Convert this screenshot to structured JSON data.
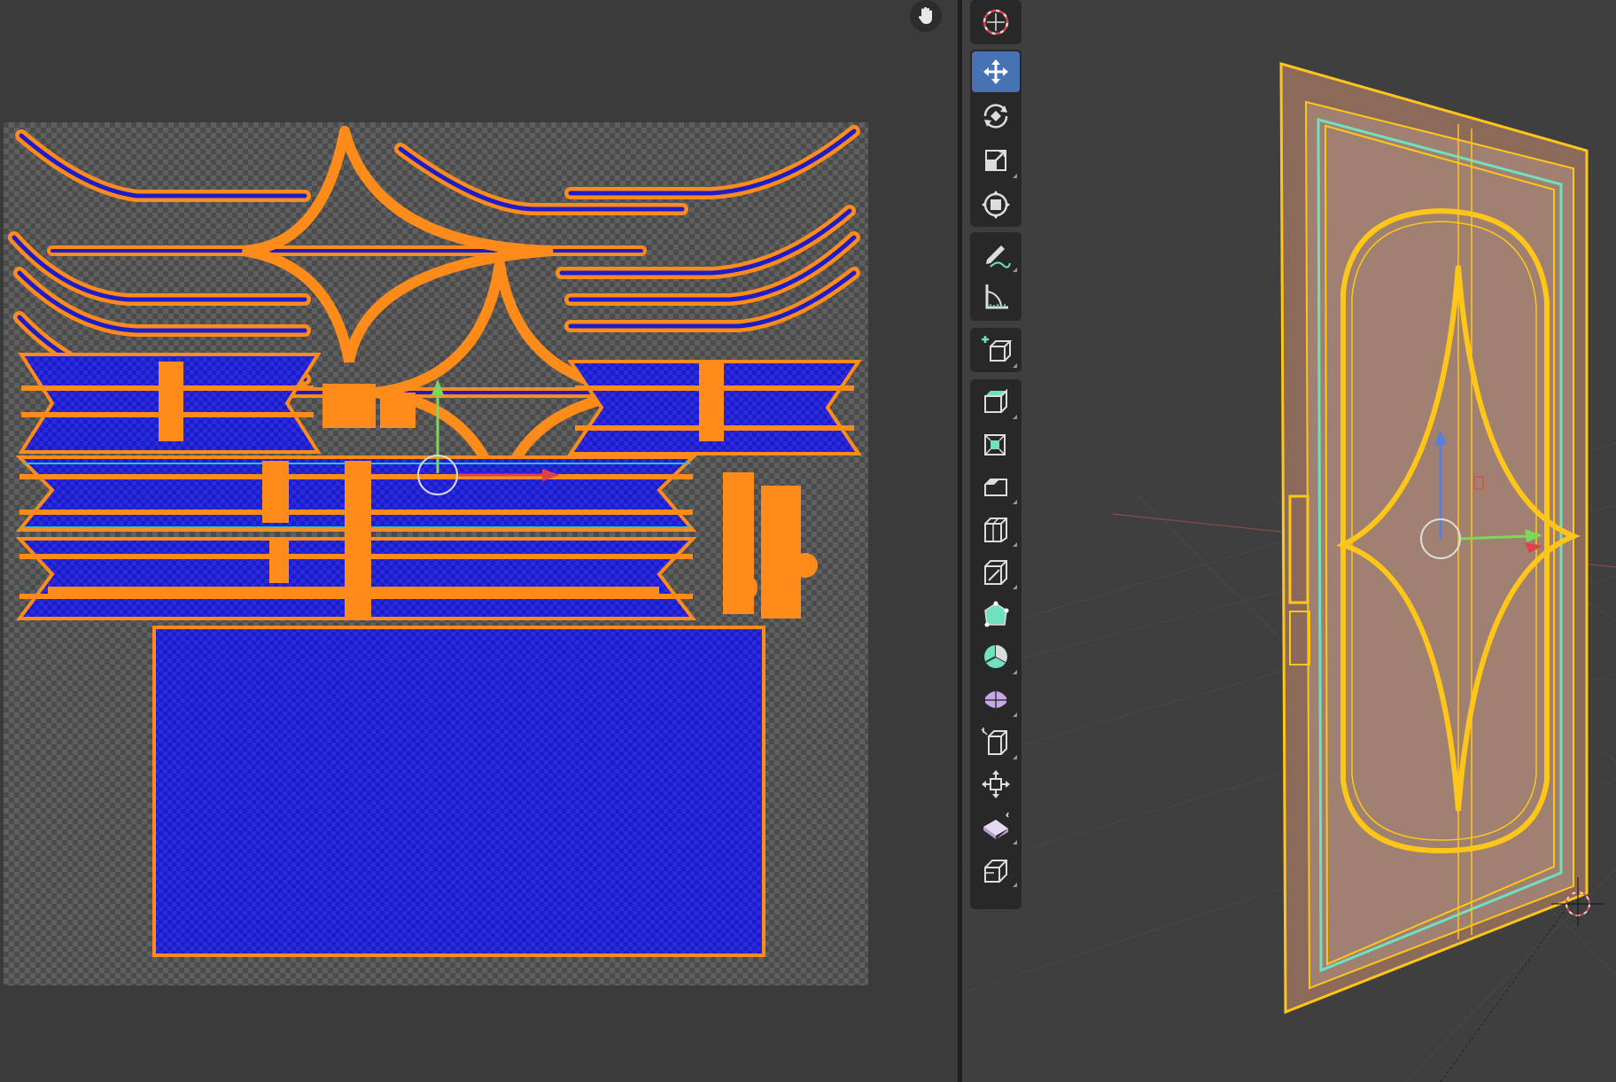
{
  "uv_editor": {
    "background": "#3b3b3b",
    "hand_icon": "hand-pan-icon",
    "selection_color": "#ff8c1a",
    "face_color": "#1f1fd6"
  },
  "viewport": {
    "background": "#3f3f3f",
    "object": "door-mesh",
    "object_color": "#ffc61a",
    "panel_fill": "#a08070"
  },
  "toolbar": {
    "tools": [
      {
        "id": "cursor",
        "icon": "cursor-icon",
        "active": false
      },
      {
        "id": "move",
        "icon": "move-icon",
        "active": true
      },
      {
        "id": "rotate",
        "icon": "rotate-icon",
        "active": false
      },
      {
        "id": "scale",
        "icon": "scale-icon",
        "active": false
      },
      {
        "id": "transform",
        "icon": "transform-icon",
        "active": false
      },
      {
        "id": "annotate",
        "icon": "annotate-icon",
        "active": false
      },
      {
        "id": "measure",
        "icon": "measure-icon",
        "active": false
      },
      {
        "id": "add-cube",
        "icon": "add-cube-icon",
        "active": false
      },
      {
        "id": "extrude",
        "icon": "extrude-region-icon",
        "active": false
      },
      {
        "id": "inset",
        "icon": "inset-faces-icon",
        "active": false
      },
      {
        "id": "bevel",
        "icon": "bevel-icon",
        "active": false
      },
      {
        "id": "loop-cut",
        "icon": "loop-cut-icon",
        "active": false
      },
      {
        "id": "knife",
        "icon": "knife-icon",
        "active": false
      },
      {
        "id": "poly-build",
        "icon": "poly-build-icon",
        "active": false
      },
      {
        "id": "spin",
        "icon": "spin-icon",
        "active": false
      },
      {
        "id": "smooth",
        "icon": "smooth-icon",
        "active": false
      },
      {
        "id": "edge-slide",
        "icon": "edge-slide-icon",
        "active": false
      },
      {
        "id": "shrink-fatten",
        "icon": "shrink-fatten-icon",
        "active": false
      },
      {
        "id": "shear",
        "icon": "shear-icon",
        "active": false
      },
      {
        "id": "rip-region",
        "icon": "rip-region-icon",
        "active": false
      }
    ]
  }
}
